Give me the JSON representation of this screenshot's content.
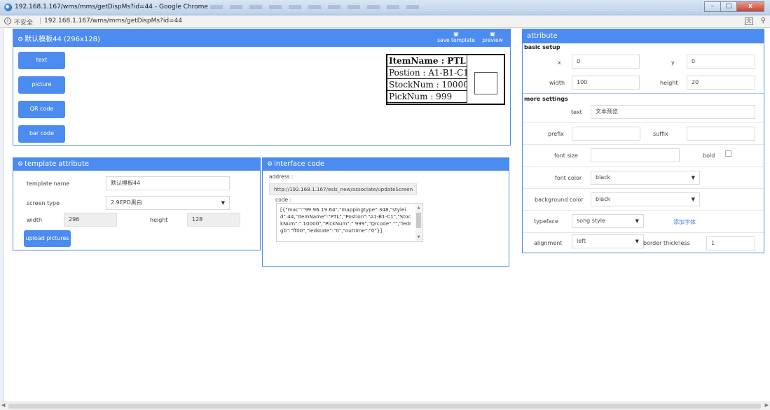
{
  "window": {
    "title": "192.168.1.167/wms/mms/getDispMs?id=44 - Google Chrome",
    "minimize": "–",
    "maximize": "□",
    "close": "x"
  },
  "addressbar": {
    "info_icon": "i",
    "insecure": "不安全",
    "separator": "|",
    "url": "192.168.1.167/wms/mms/getDispMs?id=44",
    "translate_icon": "translate-icon",
    "zoom_icon": "zoom-icon"
  },
  "canvas_panel": {
    "title": "默认模板44 (296x128)",
    "save_template": "save template",
    "preview": "preview",
    "tools": [
      "text",
      "picture",
      "QR code",
      "bar code"
    ]
  },
  "label_preview": {
    "rows": [
      "ItemName : PTL",
      "Postion : A1-B1-C1",
      "StockNum : 10000",
      "PickNum : 999"
    ]
  },
  "template_attribute": {
    "title": "template attribute",
    "name_label": "template name",
    "name_value": "默认模板44",
    "screen_type_label": "screen type",
    "screen_type_value": "2.9EPD黑白",
    "width_label": "width",
    "width_value": "296",
    "height_label": "height",
    "height_value": "128",
    "upload_button": "upload pictures"
  },
  "interface_code": {
    "title": "interface code",
    "address_label": "address :",
    "address_value": "http://192.168.1.167/esls_new/associate/updateScreen",
    "code_label": "code :",
    "code_value": "[{\"mac\":\"99.96.19.64\",\"mappingtype\":348,\"styleid\":44,\"ItemName\":\"PTL\",\"Postion\":\"A1-B1-C1\",\"StockNum\":\" 10000\",\"PickNum\":\" 999\",\"Qrcode\":\"\",\"ledrgb\":\"ff00\",\"ledstate\":\"0\",\"outtime\":\"0\"}]"
  },
  "attribute": {
    "title": "attribute",
    "basic_setup": "basic setup",
    "x_label": "x",
    "x_value": "0",
    "y_label": "y",
    "y_value": "0",
    "width_label": "width",
    "width_value": "100",
    "height_label": "height",
    "height_value": "20",
    "more_settings": "more settings",
    "text_label": "text",
    "text_value": "文本预览",
    "prefix_label": "prefix",
    "prefix_value": "",
    "suffix_label": "suffix",
    "suffix_value": "",
    "font_size_label": "font size",
    "font_size_value": "",
    "bold_label": "bold",
    "font_color_label": "font color",
    "font_color_value": "black",
    "background_color_label": "background color",
    "background_color_value": "black",
    "typeface_label": "typeface",
    "typeface_value": "song style",
    "add_font_link": "添加字体",
    "alignment_label": "alignment",
    "alignment_value": "left",
    "border_thickness_label": "border thickness",
    "border_thickness_value": "1"
  },
  "colors": {
    "accent": "#4c8cf0",
    "link": "#3d7fe6"
  }
}
